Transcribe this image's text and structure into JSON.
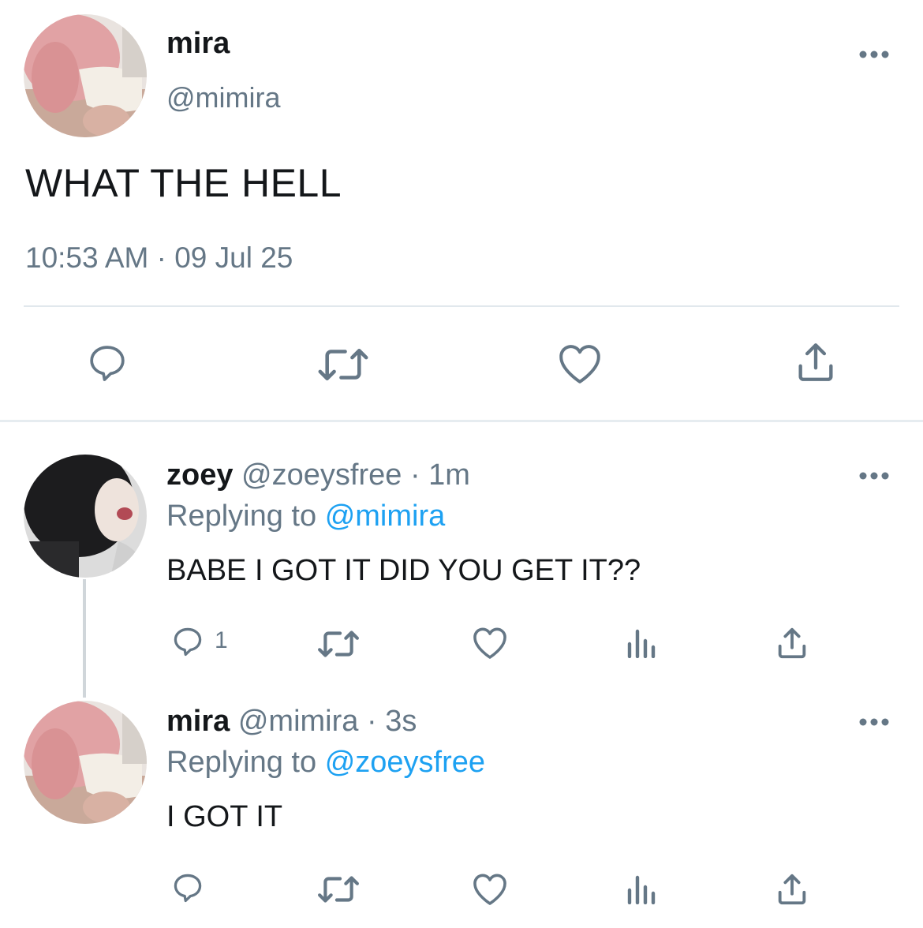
{
  "main_tweet": {
    "name": "mira",
    "handle": "@mimira",
    "text": "WHAT THE HELL",
    "timestamp": "10:53 AM · 09 Jul 25",
    "actions": [
      "reply-icon",
      "retweet-icon",
      "like-icon",
      "share-icon"
    ]
  },
  "replies": [
    {
      "name": "zoey",
      "handle": "@zoeysfree",
      "sep": "·",
      "time": "1m",
      "replying_prefix": "Replying to",
      "replying_to": "@mimira",
      "text": "BABE I GOT IT DID YOU GET IT??",
      "reply_count": "1",
      "actions": [
        "reply-icon",
        "retweet-icon",
        "like-icon",
        "analytics-icon",
        "share-icon"
      ]
    },
    {
      "name": "mira",
      "handle": "@mimira",
      "sep": "·",
      "time": "3s",
      "replying_prefix": "Replying to",
      "replying_to": "@zoeysfree",
      "text": "I GOT IT",
      "actions": [
        "reply-icon",
        "retweet-icon",
        "like-icon",
        "analytics-icon",
        "share-icon"
      ]
    }
  ],
  "colors": {
    "text": "#14171a",
    "secondary": "#657786",
    "link": "#1da1f2",
    "divider": "#e1e8ed"
  }
}
